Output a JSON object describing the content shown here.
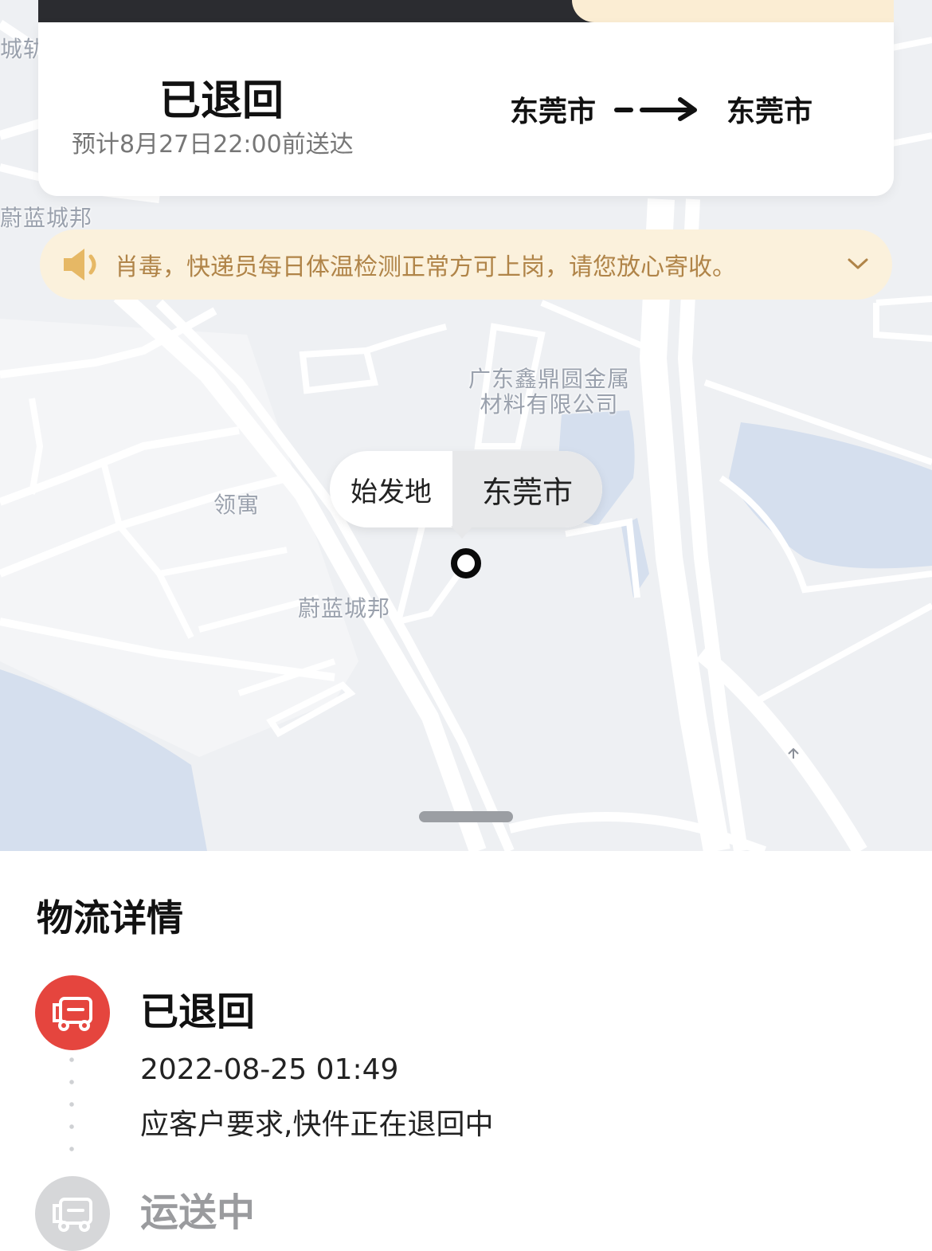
{
  "header": {
    "status": "已退回",
    "eta": "预计8月27日22:00前送达",
    "route_from": "东莞市",
    "route_to": "东莞市"
  },
  "notice": {
    "text": "肖毒，快递员每日体温检测正常方可上岗，请您放心寄收。",
    "icon": "speaker-icon",
    "expand_icon": "chevron-down-icon"
  },
  "map": {
    "labels": {
      "top_left": "城轨",
      "weilan_top": "蔚蓝城邦",
      "company": "广东鑫鼎圆金属\n材料有限公司",
      "lingyu": "领寓",
      "weilan_center": "蔚蓝城邦"
    },
    "origin_bubble": {
      "label": "始发地",
      "city": "东莞市"
    }
  },
  "details": {
    "title": "物流详情",
    "events": [
      {
        "status": "已退回",
        "time": "2022-08-25 01:49",
        "description": "应客户要求,快件正在退回中",
        "icon": "truck-icon",
        "color": "#e5453e"
      },
      {
        "status": "运送中",
        "icon": "truck-icon",
        "color": "#d6d7d9"
      }
    ]
  },
  "colors": {
    "accent_red": "#e5453e",
    "notice_bg": "#fbf1dc",
    "notice_text": "#b08448",
    "map_bg": "#eef0f3",
    "water": "#d5dfee"
  }
}
